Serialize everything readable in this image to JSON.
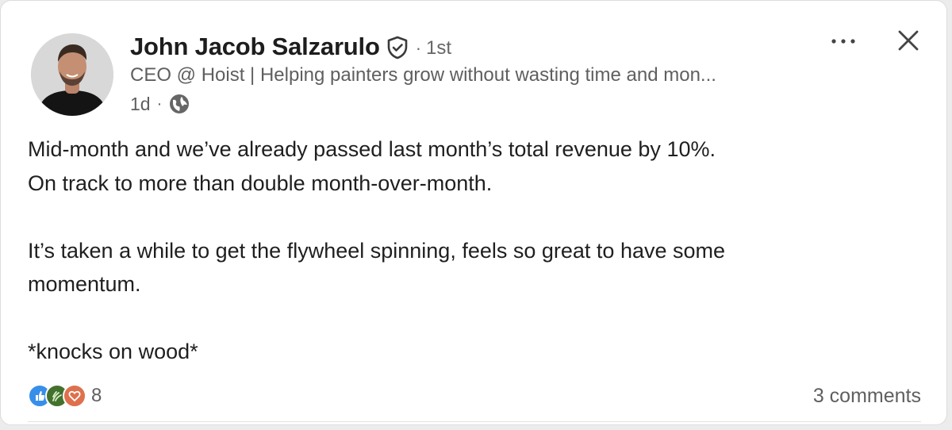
{
  "post": {
    "author": {
      "name": "John Jacob Salzarulo",
      "degree": "1st",
      "separator": "·",
      "headline": "CEO @ Hoist | Helping painters grow without wasting time and mon...",
      "posted": "1d",
      "visibility_icon": "globe-icon",
      "verified_icon": "verified-shield-icon"
    },
    "body": {
      "paragraph1_line1": "Mid-month and we’ve already passed last month’s total revenue by 10%.",
      "paragraph1_line2": "On track to more than double month-over-month.",
      "paragraph2_line1": "It’s taken a while to get the flywheel spinning, feels so great to have some",
      "paragraph2_line2": "momentum.",
      "paragraph3": "*knocks on wood*"
    },
    "social": {
      "reaction_icons": [
        "like-icon",
        "celebrate-icon",
        "love-icon"
      ],
      "reaction_count": "8",
      "comments": "3 comments"
    },
    "controls": {
      "more_icon": "more-options-icon",
      "close_icon": "close-icon"
    },
    "colors": {
      "like": "#378fe9",
      "celebrate": "#44712e",
      "love": "#df704d",
      "text_primary": "#1f1f1f",
      "text_secondary": "#5f5f5f"
    }
  }
}
